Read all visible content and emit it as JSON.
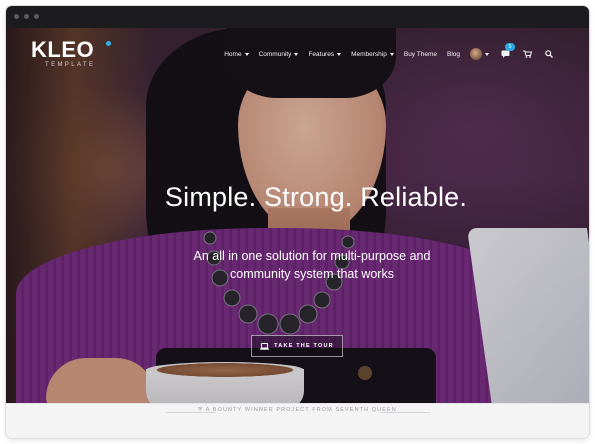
{
  "window": {
    "controls": [
      "close",
      "minimize",
      "zoom"
    ]
  },
  "brand": {
    "name": "KLEO",
    "sub": "TEMPLATE",
    "accent": "#2fb0e0"
  },
  "nav": {
    "items": [
      {
        "label": "Home",
        "has_dropdown": true
      },
      {
        "label": "Community",
        "has_dropdown": true
      },
      {
        "label": "Features",
        "has_dropdown": true
      },
      {
        "label": "Membership",
        "has_dropdown": true
      },
      {
        "label": "Buy Theme",
        "has_dropdown": false
      },
      {
        "label": "Blog",
        "has_dropdown": false
      }
    ],
    "notification_count": "5",
    "icons": [
      "avatar",
      "chevron-down-icon",
      "messages-icon",
      "cart-icon",
      "search-icon"
    ]
  },
  "hero": {
    "headline": "Simple. Strong. Reliable.",
    "tagline": "An all in one solution for multi-purpose and community system that works",
    "cta_label": "TAKE THE TOUR",
    "cta_icon": "laptop-icon"
  },
  "footer": {
    "text": "A BOUNTY WINNER PROJECT FROM SEVENTH QUEEN",
    "icon": "trophy-icon"
  }
}
